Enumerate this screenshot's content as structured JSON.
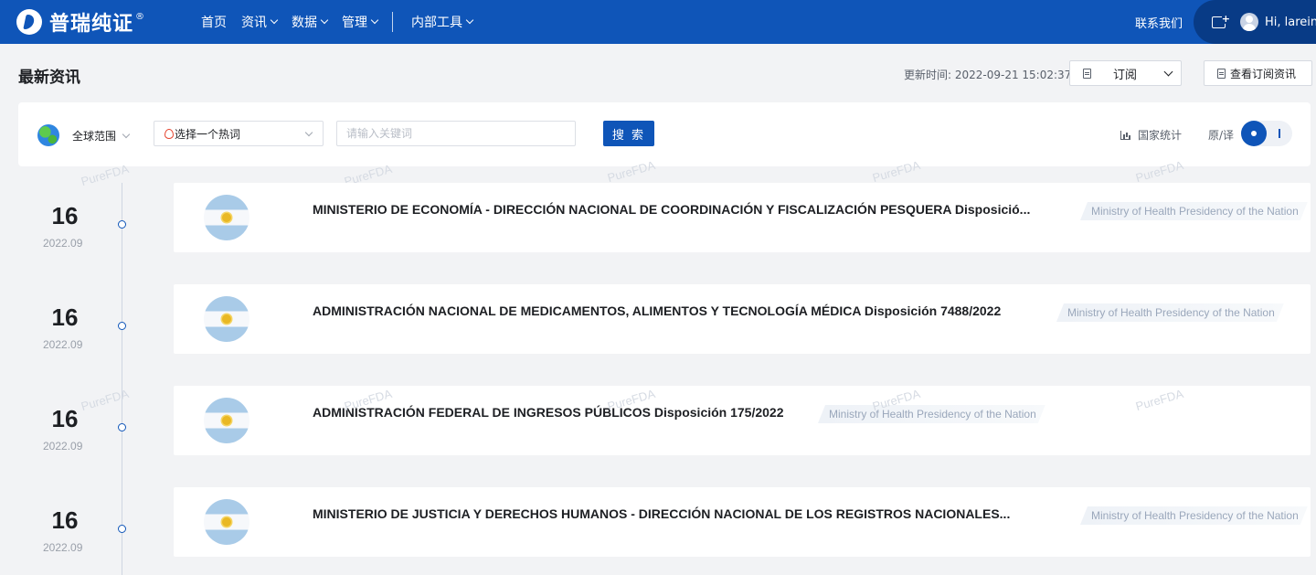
{
  "brand": {
    "name": "普瑞纯证",
    "reg_mark": "®"
  },
  "nav": {
    "items": [
      {
        "label": "首页",
        "has_dropdown": false
      },
      {
        "label": "资讯",
        "has_dropdown": true
      },
      {
        "label": "数据",
        "has_dropdown": true
      },
      {
        "label": "管理",
        "has_dropdown": true
      }
    ],
    "tools": {
      "label": "内部工具",
      "has_dropdown": true
    },
    "contact": "联系我们",
    "greeting": "Hi, lareina"
  },
  "header": {
    "title": "最新资讯",
    "update_time": "更新时间: 2022-09-21 15:02:37",
    "subscribe_label": "订阅",
    "view_subscriptions_label": "查看订阅资讯"
  },
  "filters": {
    "scope": "全球范围",
    "hotword_placeholder": "选择一个热词",
    "keyword_placeholder": "请输入关键词",
    "search_label": "搜 索",
    "national_stats": "国家统计",
    "orig_trans_label": "原/译",
    "translate_on": true
  },
  "watermark": "PureFDA",
  "news": [
    {
      "day": "16",
      "year_month": "2022.09",
      "title": "MINISTERIO DE ECONOMÍA - DIRECCIÓN NACIONAL DE COORDINACIÓN Y FISCALIZACIÓN PESQUERA Disposició...",
      "source": "Ministry of Health Presidency of the Nation",
      "flag": "argentina-flag"
    },
    {
      "day": "16",
      "year_month": "2022.09",
      "title": "ADMINISTRACIÓN NACIONAL DE MEDICAMENTOS, ALIMENTOS Y TECNOLOGÍA MÉDICA Disposición 7488/2022",
      "source": "Ministry of Health Presidency of the Nation",
      "flag": "argentina-flag"
    },
    {
      "day": "16",
      "year_month": "2022.09",
      "title": "ADMINISTRACIÓN FEDERAL DE INGRESOS PÚBLICOS Disposición 175/2022",
      "source": "Ministry of Health Presidency of the Nation",
      "flag": "argentina-flag"
    },
    {
      "day": "16",
      "year_month": "2022.09",
      "title": "MINISTERIO DE JUSTICIA Y DERECHOS HUMANOS - DIRECCIÓN NACIONAL DE LOS REGISTROS NACIONALES...",
      "source": "Ministry of Health Presidency of the Nation",
      "flag": "argentina-flag"
    }
  ],
  "colors": {
    "primary": "#0f55b8",
    "primary_dark": "#083b86",
    "background": "#f2f3f5",
    "card": "#ffffff",
    "text": "#1d1f23",
    "muted": "#9aa0aa"
  }
}
